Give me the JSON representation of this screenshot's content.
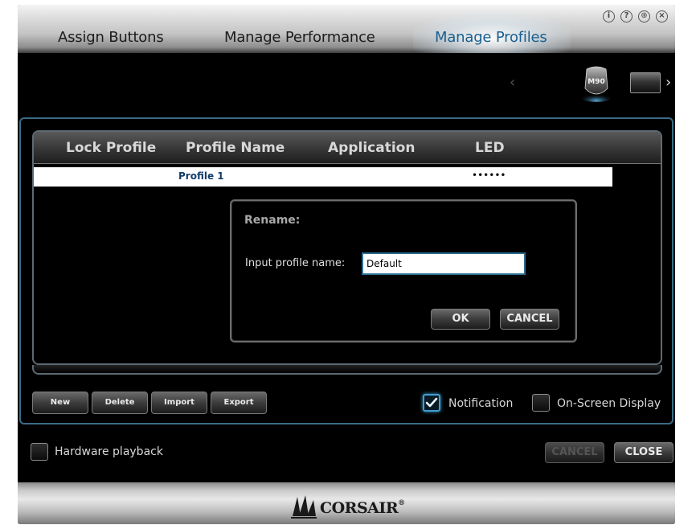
{
  "tabs": [
    {
      "label": "Assign Buttons",
      "active": false
    },
    {
      "label": "Manage Performance",
      "active": false
    },
    {
      "label": "Manage Profiles",
      "active": true
    }
  ],
  "window_icons": [
    "info-icon",
    "help-icon",
    "globe-icon",
    "close-icon"
  ],
  "devices": {
    "mouse_label": "M90"
  },
  "table": {
    "columns": [
      "Lock Profile",
      "Profile Name",
      "Application",
      "LED"
    ],
    "rows": [
      {
        "name": "Profile 1",
        "led": "••••••"
      }
    ]
  },
  "dialog": {
    "title": "Rename:",
    "field_label": "Input profile name:",
    "field_value": "Default",
    "ok_label": "OK",
    "cancel_label": "CANCEL"
  },
  "profile_buttons": {
    "new": "New",
    "delete": "Delete",
    "import": "Import",
    "export": "Export"
  },
  "options": {
    "notification_label": "Notification",
    "notification_checked": true,
    "osd_label": "On-Screen Display",
    "osd_checked": false,
    "hardware_playback_label": "Hardware playback",
    "hardware_playback_checked": false
  },
  "bottom_buttons": {
    "cancel_label": "CANCEL",
    "close_label": "CLOSE"
  },
  "brand": {
    "name": "CORSAIR",
    "mark": "®"
  },
  "colors": {
    "accent": "#3e9fd3",
    "active_tab": "#1a5f8f",
    "profile_name": "#123d6a"
  }
}
